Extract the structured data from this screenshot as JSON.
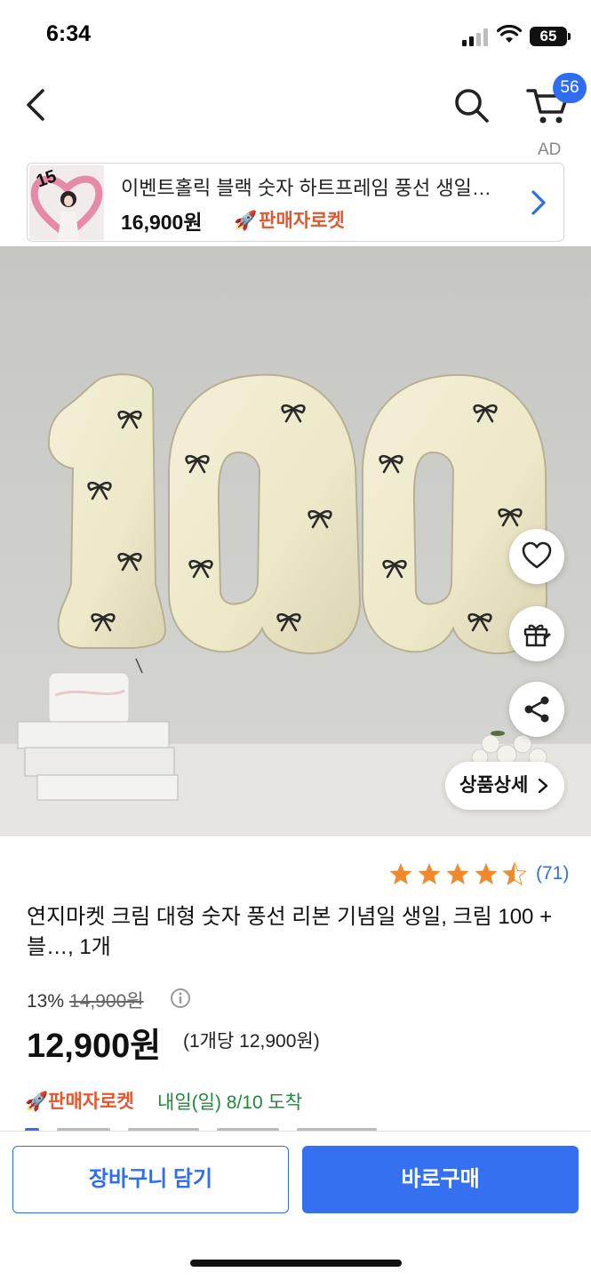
{
  "status_bar": {
    "time": "6:34",
    "battery": "65"
  },
  "nav": {
    "cart_count": "56",
    "ad_label": "AD"
  },
  "ad_banner": {
    "title": "이벤트홀릭 블랙 숫자 하트프레임 풍선 생일…",
    "price": "16,900원",
    "badge": "판매자로켓",
    "thumb_number": "15"
  },
  "hero": {
    "detail_button": "상품상세"
  },
  "product": {
    "rating_count": "(71)",
    "rating": 4.5,
    "title": "연지마켓 크림 대형 숫자 풍선 리본 기념일 생일, 크림 100 + 블…, 1개",
    "discount_percent": "13%",
    "original_price": "14,900원",
    "price": "12,900원",
    "unit_price": "(1개당 12,900원)",
    "delivery_badge": "판매자로켓",
    "delivery_date": "내일(일) 8/10 도착"
  },
  "bottom_bar": {
    "add_to_cart": "장바구니 담기",
    "buy_now": "바로구매"
  },
  "colors": {
    "accent": "#2f6df0",
    "rocket": "#e4572e",
    "delivery": "#1f8a3a",
    "star": "#f08a2c"
  },
  "icons": [
    "back-icon",
    "search-icon",
    "cart-icon",
    "chevron-right-icon",
    "heart-icon",
    "gift-icon",
    "share-icon",
    "info-icon",
    "star-icon",
    "rocket-icon"
  ]
}
